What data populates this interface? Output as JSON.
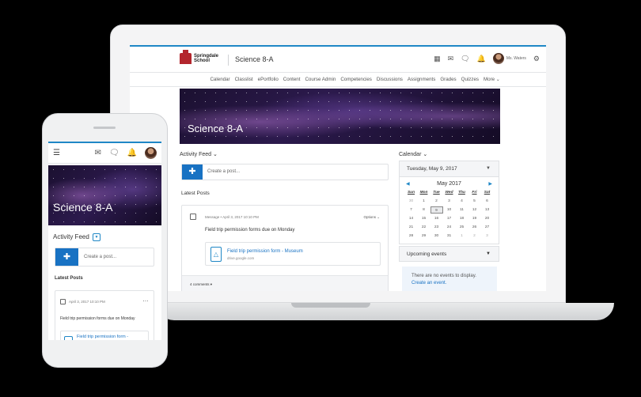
{
  "laptop": {
    "logo_text": "Springdale School",
    "course_title": "Science 8-A",
    "user_name": "Ms. Waters",
    "nav": [
      "Calendar",
      "Classlist",
      "ePortfolio",
      "Content",
      "Course Admin",
      "Competencies",
      "Discussions",
      "Assignments",
      "Grades",
      "Quizzes",
      "More ⌄"
    ],
    "banner_title": "Science 8-A",
    "activity_feed_label": "Activity Feed ⌄",
    "create_post_placeholder": "Create a post...",
    "latest_posts_label": "Latest Posts",
    "post": {
      "meta": "Message • April 3, 2017 10:10 PM",
      "options": "Options ⌄",
      "body": "Field trip permission forms due on Monday",
      "attachment_title": "Field trip permission form - Museum",
      "attachment_source": "drive.google.com",
      "comments": "4 comments ▾"
    },
    "calendar": {
      "label": "Calendar ⌄",
      "current_date": "Tuesday, May 9, 2017",
      "month": "May 2017",
      "weekdays": [
        "Sun",
        "Mon",
        "Tue",
        "Wed",
        "Thu",
        "Fri",
        "Sat"
      ],
      "days": [
        "30",
        "1",
        "2",
        "3",
        "4",
        "5",
        "6",
        "7",
        "8",
        "9",
        "10",
        "11",
        "12",
        "13",
        "14",
        "15",
        "16",
        "17",
        "18",
        "19",
        "20",
        "21",
        "22",
        "23",
        "24",
        "25",
        "26",
        "27",
        "28",
        "29",
        "30",
        "31",
        "1",
        "2",
        "3"
      ],
      "selected_day_index": 9
    },
    "upcoming": {
      "label": "Upcoming events",
      "empty_text": "There are no events to display.",
      "create_link": "Create an event."
    }
  },
  "phone": {
    "banner_title": "Science 8-A",
    "activity_feed_label": "Activity Feed",
    "create_post_placeholder": "Create a post...",
    "latest_posts_label": "Latest Posts",
    "post": {
      "meta": "April 3, 2017 10:10 PM",
      "body": "Field trip permission forms due on Monday",
      "attachment_title": "Field trip permission form -"
    }
  },
  "colors": {
    "accent": "#1872c3",
    "brand_red": "#b3262d"
  },
  "icons": [
    "grid-icon",
    "mail-icon",
    "chat-icon",
    "bell-icon",
    "gear-icon",
    "menu-icon",
    "plus-icon",
    "calendar-post-icon",
    "drive-file-icon"
  ]
}
